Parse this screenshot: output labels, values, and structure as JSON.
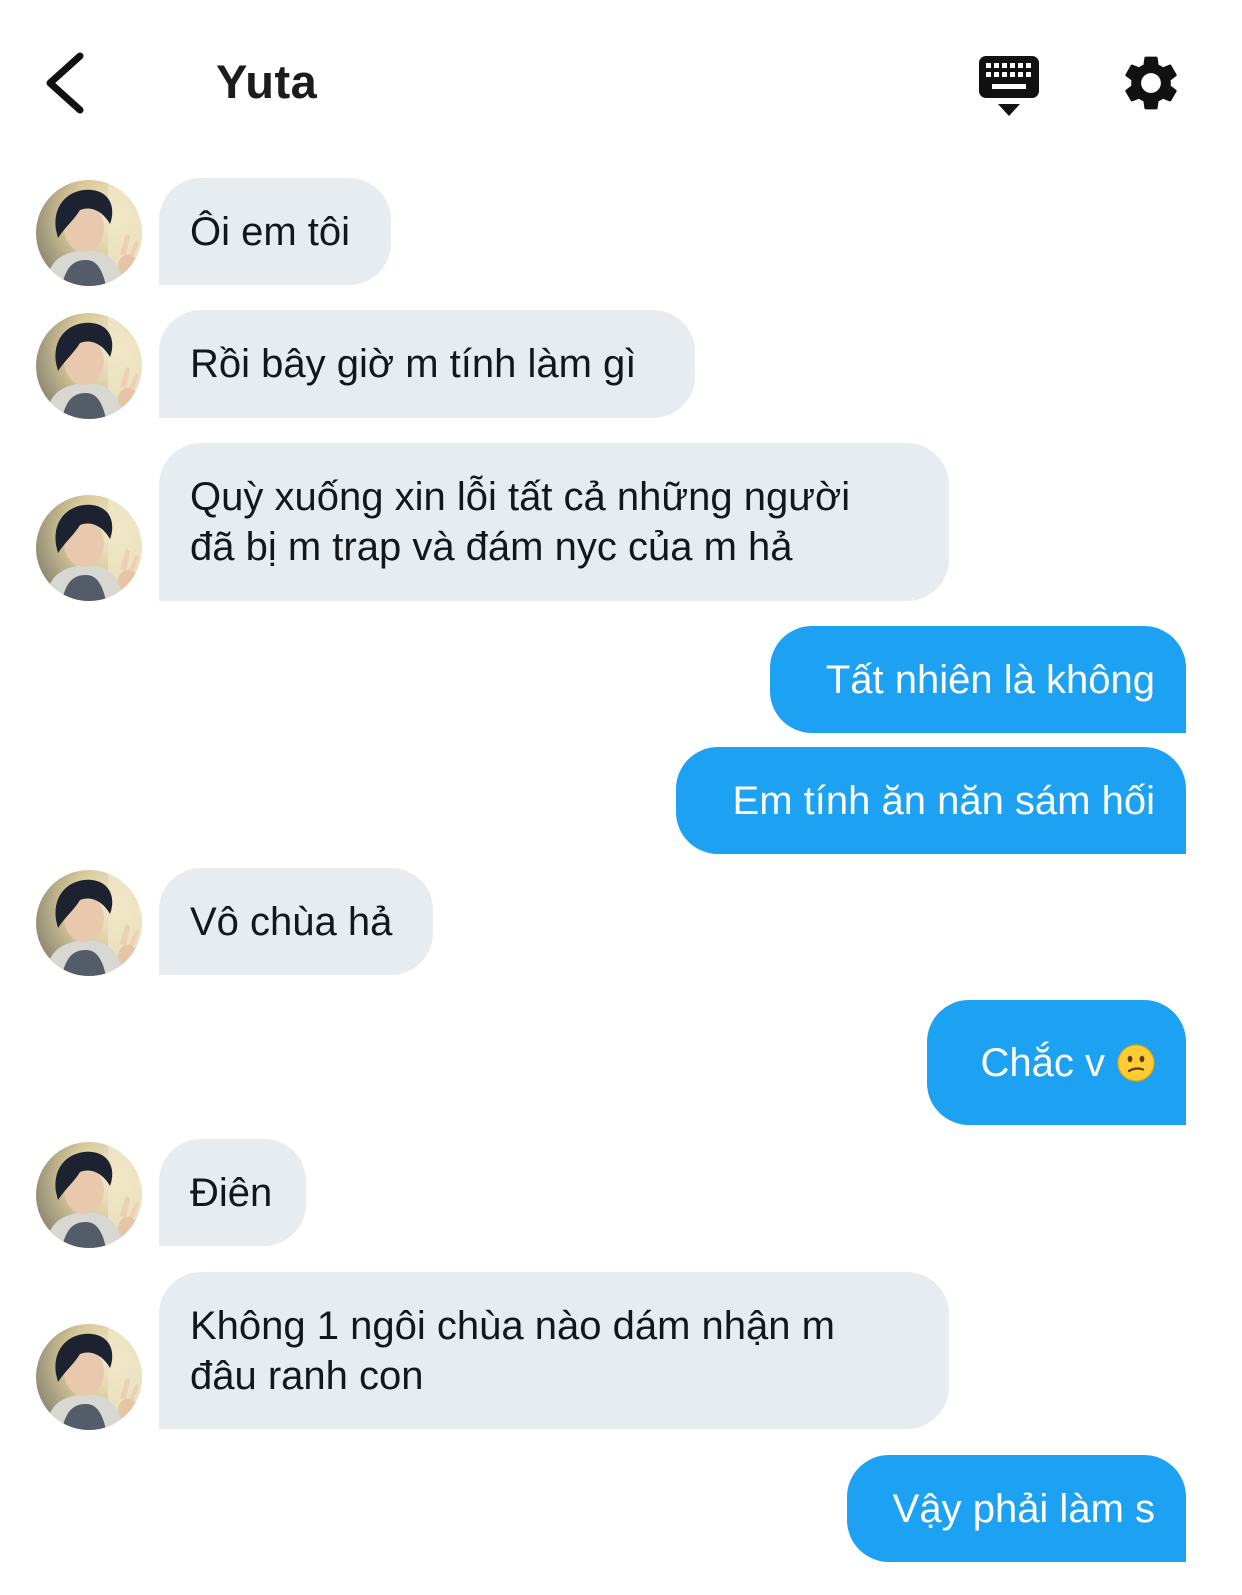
{
  "header": {
    "title": "Yuta",
    "back_icon": "chevron-left-icon",
    "keyboard_icon": "keyboard-icon",
    "settings_icon": "gear-icon"
  },
  "colors": {
    "incoming_bubble": "#e6ecf0",
    "outgoing_bubble": "#1da1f2",
    "text": "#14171a"
  },
  "messages": [
    {
      "from": "Yuta",
      "text": "Ôi em tôi"
    },
    {
      "from": "Yuta",
      "text": "Rồi bây giờ m tính làm gì"
    },
    {
      "from": "Yuta",
      "text": "Quỳ xuống xin lỗi tất cả những người\nđã bị m trap và đám nyc của m hả"
    },
    {
      "from": "me",
      "text": "Tất nhiên là không"
    },
    {
      "from": "me",
      "text": "Em tính ăn năn sám hối"
    },
    {
      "from": "Yuta",
      "text": "Vô chùa hả"
    },
    {
      "from": "me",
      "text": "Chắc v",
      "emoji": "confused-face-emoji"
    },
    {
      "from": "Yuta",
      "text": "Điên"
    },
    {
      "from": "Yuta",
      "text": "Không 1 ngôi chùa nào dám nhận m\nđâu ranh con"
    },
    {
      "from": "me",
      "text": "Vậy phải làm s"
    }
  ]
}
